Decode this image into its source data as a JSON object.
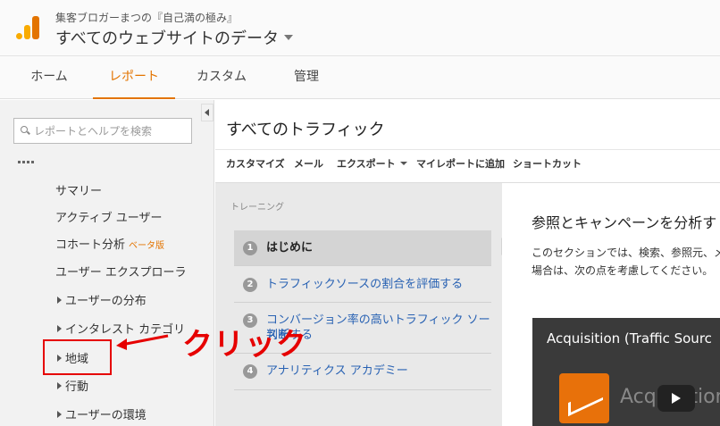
{
  "header": {
    "account": "集客ブロガーまつの『自己満の極み』",
    "view": "すべてのウェブサイトのデータ"
  },
  "nav": {
    "tabs": [
      {
        "label": "ホーム"
      },
      {
        "label": "レポート"
      },
      {
        "label": "カスタム"
      },
      {
        "label": "管理"
      }
    ],
    "active": "レポート"
  },
  "sidebar": {
    "search_placeholder": "レポートとヘルプを検索",
    "items": [
      {
        "label": "サマリー"
      },
      {
        "label": "アクティブ ユーザー"
      },
      {
        "label": "コホート分析",
        "badge": "ベータ版"
      },
      {
        "label": "ユーザー エクスプローラ"
      },
      {
        "label": "ユーザーの分布"
      },
      {
        "label": "インタレスト カテゴリ"
      },
      {
        "label": "地域"
      },
      {
        "label": "行動"
      },
      {
        "label": "ユーザーの環境"
      }
    ]
  },
  "content": {
    "title": "すべてのトラフィック",
    "toolbar": [
      "カスタマイズ",
      "メール",
      "エクスポート",
      "マイレポートに追加",
      "ショートカット"
    ]
  },
  "training": {
    "label": "トレーニング",
    "steps": [
      {
        "num": "1",
        "text": "はじめに"
      },
      {
        "num": "2",
        "text": "トラフィックソースの割合を評価する"
      },
      {
        "num": "3",
        "text_line1": "コンバージョン率の高いトラフィック ソースを",
        "text_line2": "判断する"
      },
      {
        "num": "4",
        "text": "アナリティクス アカデミー"
      }
    ]
  },
  "panel": {
    "heading": "参照とキャンペーンを分析す",
    "para_line1": "このセクションでは、検索、参照元、メー",
    "para_line2": "場合は、次の点を考慮してください。",
    "video_title": "Acquisition (Traffic Sourc",
    "video_word": "Acquisition"
  },
  "annotation": {
    "text": "クリック",
    "color": "#e60000"
  },
  "colors": {
    "accent": "#e37400",
    "link": "#2962b3"
  }
}
